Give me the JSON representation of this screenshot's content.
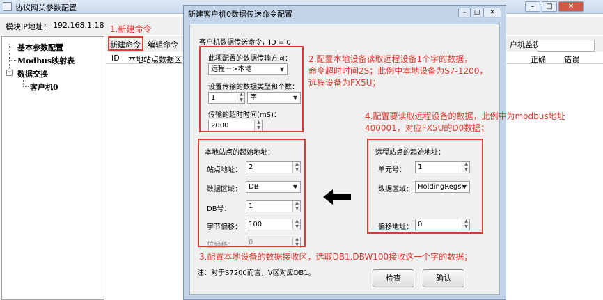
{
  "window": {
    "title": "协议网关参数配置",
    "ip_label": "模块IP地址：",
    "ip_value": "192.168.1.18"
  },
  "tree": {
    "items": [
      "基本参数配置",
      "Modbus映射表",
      "数据交换",
      "客户机0"
    ]
  },
  "toolbar": {
    "new_label": "新建命令",
    "edit_label": "编辑命令",
    "right_label": "户机监视"
  },
  "grid": {
    "columns": [
      "ID",
      "本地站点数据区",
      "正确",
      "错误"
    ]
  },
  "dialog": {
    "title": "新建客户机0数据传送命令配置",
    "subtitle": "客户机数据传送命令，ID = 0",
    "direction_label": "此项配置的数据传输方向：",
    "direction_value": "远程一>本地",
    "type_count_label": "设置传输的数据类型和个数：",
    "count_value": "1",
    "type_value": "字",
    "timeout_label": "传输的超时时间(mS)：",
    "timeout_value": "2000",
    "local_group_label": "本地站点的起始地址：",
    "station_label": "站点地址：",
    "station_value": "2",
    "area_label": "数据区域：",
    "area_value": "DB",
    "db_label": "DB号：",
    "db_value": "1",
    "byte_offset_label": "字节偏移：",
    "byte_offset_value": "100",
    "bit_offset_label": "位偏移：",
    "bit_offset_value": "0",
    "remote_group_label": "远程站点的起始地址：",
    "unit_label": "单元号：",
    "unit_value": "1",
    "remote_area_label": "数据区域：",
    "remote_area_value": "HoldingRegsi",
    "remote_offset_label": "偏移地址：",
    "remote_offset_value": "0",
    "footnote": "注：对于S7200而言，V区对应DB1。",
    "check_button": "检查",
    "ok_button": "确认"
  },
  "annotations": {
    "note1": "1.新建命令",
    "note2_line1": "2.配置本地设备读取远程设备1个字的数据，",
    "note2_line2": "命令超时时间2S；此例中本地设备为S7-1200，",
    "note2_line3": "远程设备为FX5U；",
    "note4_line1": "4.配置要读取远程设备的数据，此例中为modbus地址",
    "note4_line2": "400001，对应FX5U的D0数据；",
    "note3": "3.配置本地设备的数据接收区，选取DB1.DBW100接收这一个字的数据；",
    "color": "#e03a30"
  }
}
